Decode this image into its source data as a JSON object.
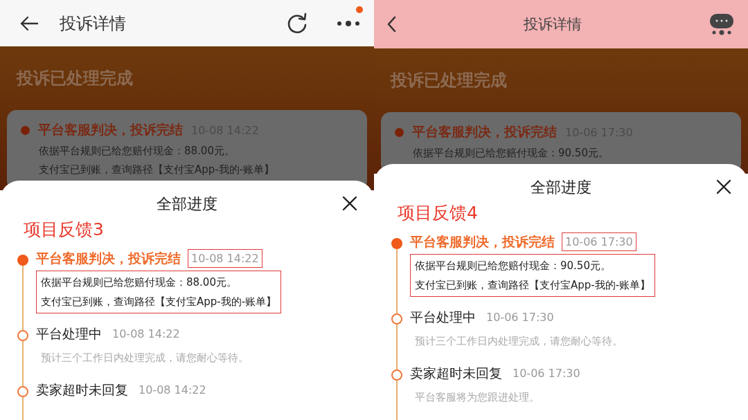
{
  "panels": [
    {
      "app_bar": {
        "kind": "white",
        "title": "投诉详情",
        "actions": [
          {
            "kind": "refresh"
          },
          {
            "kind": "more",
            "badge": true
          }
        ]
      },
      "banner_title": "投诉已处理完成",
      "background_card": {
        "title": "平台客服判决，投诉完结",
        "time": "10-08 14:22",
        "lines": [
          "依据平台规则已给您赔付现金：88.00元。",
          "支付宝已到账，查询路径【支付宝App-我的-账单】"
        ]
      },
      "sheet": {
        "title": "全部进度",
        "annotation": "项目反馈3",
        "steps": [
          {
            "title": "平台客服判决，投诉完结",
            "time": "10-08 14:22",
            "current": true,
            "time_boxed": true,
            "body_boxed": true,
            "lines": [
              "依据平台规则已给您赔付现金：88.00元。",
              "支付宝已到账，查询路径【支付宝App-我的-账单】"
            ]
          },
          {
            "title": "平台处理中",
            "time": "10-08 14:22",
            "current": false,
            "time_boxed": false,
            "body_boxed": false,
            "lines": [
              "预计三个工作日内处理完成，请您耐心等待。"
            ]
          },
          {
            "title": "卖家超时未回复",
            "time": "10-08 14:22",
            "current": false,
            "time_boxed": false
          }
        ]
      }
    },
    {
      "app_bar": {
        "kind": "pink",
        "title": "投诉详情",
        "actions": [
          {
            "kind": "chat"
          }
        ]
      },
      "banner_title": "投诉已处理完成",
      "background_card": {
        "title": "平台客服判决，投诉完结",
        "time": "10-06 17:30",
        "lines": [
          "依据平台规则已给您赔付现金：90.50元。"
        ]
      },
      "sheet": {
        "title": "全部进度",
        "annotation": "项目反馈4",
        "steps": [
          {
            "title": "平台客服判决，投诉完结",
            "time": "10-06 17:30",
            "current": true,
            "time_boxed": true,
            "body_boxed": true,
            "lines": [
              "依据平台规则已给您赔付现金：90.50元。",
              "支付宝已到账，查询路径【支付宝App-我的-账单】"
            ]
          },
          {
            "title": "平台处理中",
            "time": "10-06 17:30",
            "current": false,
            "time_boxed": false,
            "body_boxed": false,
            "lines": [
              "预计三个工作日内处理完成，请您耐心等待。"
            ]
          },
          {
            "title": "卖家超时未回复",
            "time": "10-06 17:30",
            "current": false,
            "time_boxed": false,
            "body_boxed": false,
            "lines": [
              "平台客服将为您跟进处理。"
            ]
          }
        ]
      }
    }
  ]
}
